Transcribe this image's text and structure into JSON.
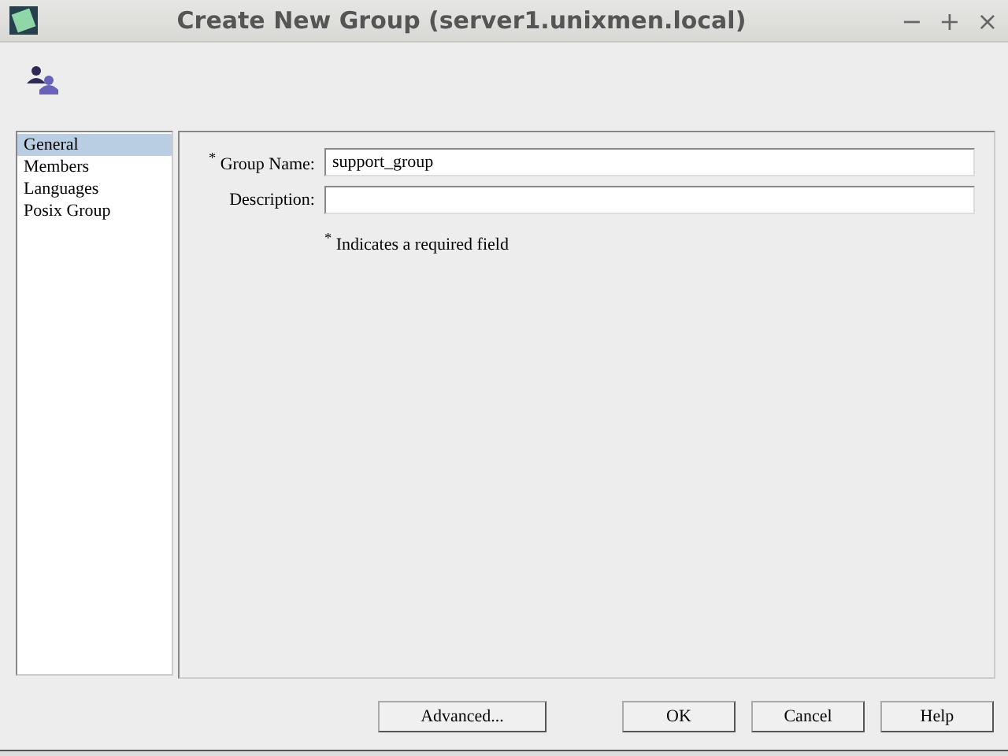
{
  "window": {
    "title": "Create New Group (server1.unixmen.local)",
    "controls": [
      "−",
      "+",
      "×"
    ]
  },
  "sidebar": {
    "items": [
      {
        "label": "General",
        "selected": true
      },
      {
        "label": "Members",
        "selected": false
      },
      {
        "label": "Languages",
        "selected": false
      },
      {
        "label": "Posix Group",
        "selected": false
      }
    ]
  },
  "form": {
    "fields": [
      {
        "label": "$^{*}$ Group Name:",
        "value": "support_group"
      },
      {
        "label": "Description:"
      }
    ],
    "note": "$^{*}$ Indicates a required field"
  },
  "buttons": [
    "Advanced...",
    "OK",
    "Cancel",
    "Help"
  ]
}
